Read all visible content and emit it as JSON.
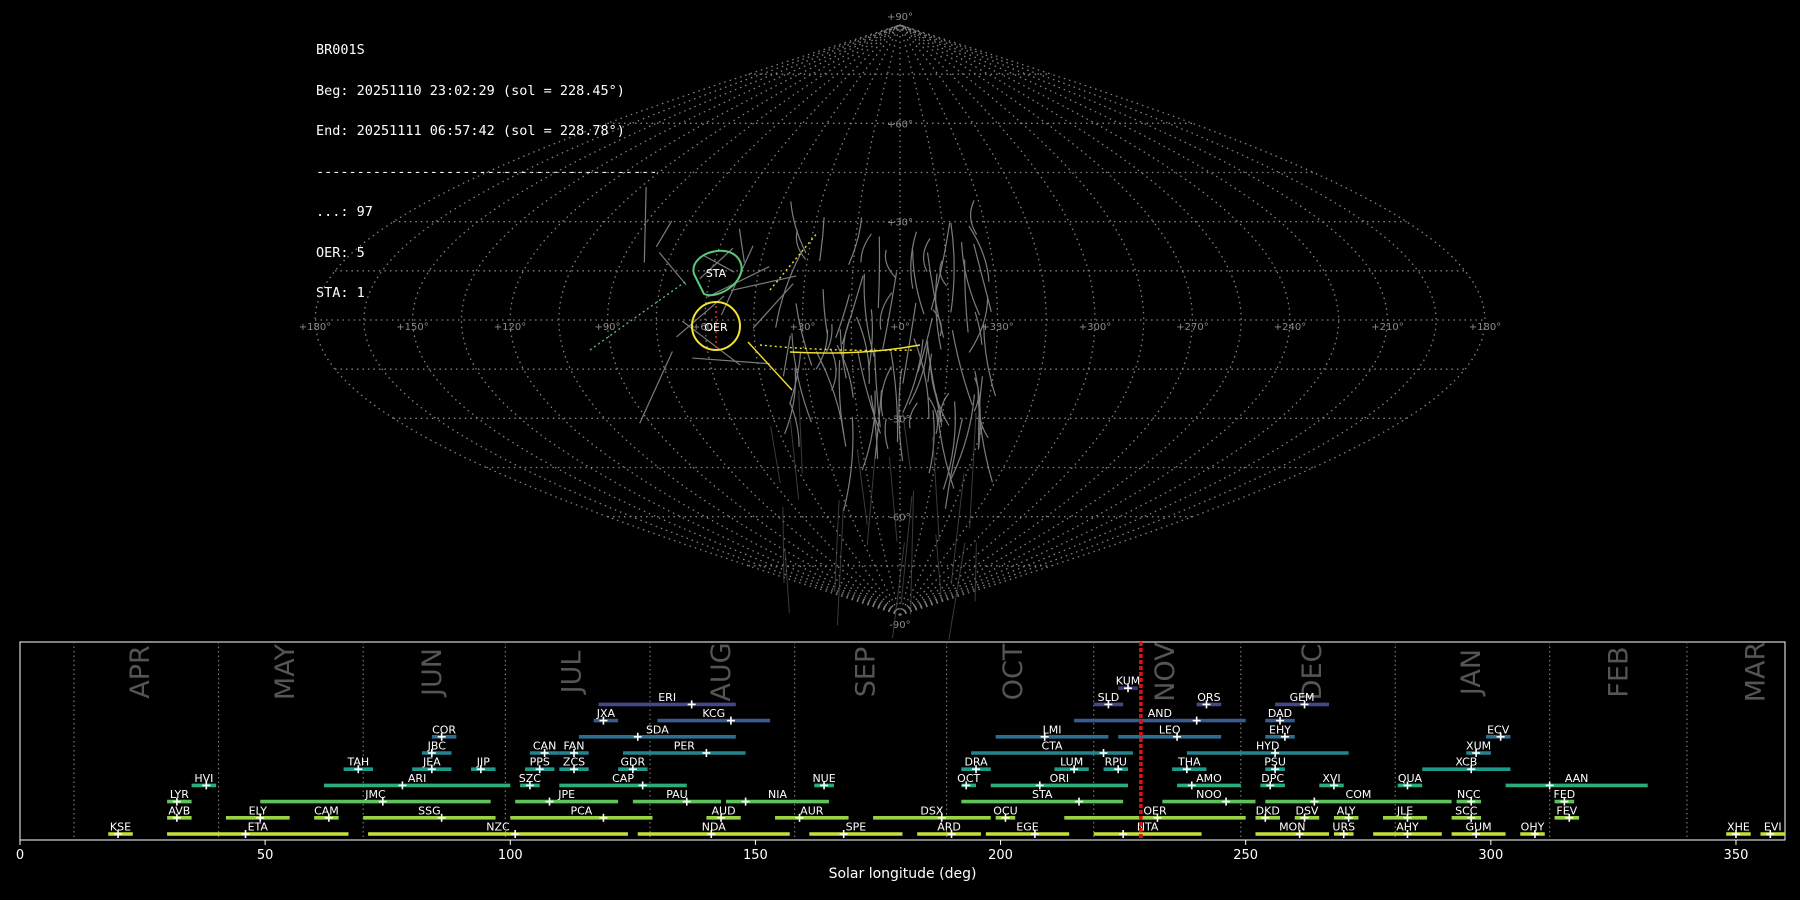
{
  "info": {
    "station": "BR001S",
    "beg": "Beg: 20251110 23:02:29 (sol = 228.45°)",
    "end": "End: 20251111 06:57:42 (sol = 228.78°)",
    "separator": "------------------------------------------",
    "counts": [
      "...: 97",
      "OER: 5",
      "STA: 1"
    ]
  },
  "sky": {
    "lat_labels": [
      "+90°",
      "+60°",
      "+30°",
      "-30°",
      "-60°",
      "-90°"
    ],
    "lon_labels": [
      "+180°",
      "+150°",
      "+120°",
      "+90°",
      "+60°",
      "+30°",
      "+0°",
      "+330°",
      "+300°",
      "+270°",
      "+240°",
      "+210°",
      "+180°"
    ],
    "radiants": [
      {
        "code": "STA",
        "lon": 58,
        "lat": 10,
        "color": "#5cc87a"
      },
      {
        "code": "OER",
        "lon": 58,
        "lat": 0,
        "color": "#f2e330"
      }
    ],
    "line_color": "#8a8a8a",
    "grid_color": "#9a9a9a"
  },
  "chart_data": {
    "type": "timeline",
    "xlabel": "Solar longitude (deg)",
    "xlim": [
      0,
      360
    ],
    "xticks": [
      0,
      50,
      100,
      150,
      200,
      250,
      300,
      350
    ],
    "current_sol": [
      228.45,
      228.78
    ],
    "months": [
      {
        "name": "APR",
        "start": 11,
        "mid": 24.5
      },
      {
        "name": "MAY",
        "start": 40.5,
        "mid": 54
      },
      {
        "name": "JUN",
        "start": 70,
        "mid": 84
      },
      {
        "name": "JUL",
        "start": 99,
        "mid": 112.5
      },
      {
        "name": "AUG",
        "start": 128.5,
        "mid": 143
      },
      {
        "name": "SEP",
        "start": 158,
        "mid": 172.5
      },
      {
        "name": "OCT",
        "start": 189,
        "mid": 202.5
      },
      {
        "name": "NOV",
        "start": 219,
        "mid": 233.5
      },
      {
        "name": "DEC",
        "start": 249,
        "mid": 263.5
      },
      {
        "name": "JAN",
        "start": 280.5,
        "mid": 296
      },
      {
        "name": "FEB",
        "start": 312,
        "mid": 326
      },
      {
        "name": "MAR",
        "start": 340,
        "mid": 354
      }
    ],
    "showers": [
      {
        "code": "KUM",
        "start": 224,
        "end": 228,
        "peak": 226,
        "row": 10
      },
      {
        "code": "ERI",
        "start": 118,
        "end": 146,
        "peak": 137,
        "row": 9
      },
      {
        "code": "SLD",
        "start": 219,
        "end": 225,
        "peak": 222,
        "row": 9
      },
      {
        "code": "ORS",
        "start": 240,
        "end": 245,
        "peak": 242,
        "row": 9
      },
      {
        "code": "GEM",
        "start": 256,
        "end": 267,
        "peak": 262,
        "row": 9
      },
      {
        "code": "JXA",
        "start": 117,
        "end": 122,
        "peak": 119,
        "row": 8
      },
      {
        "code": "KCG",
        "start": 130,
        "end": 153,
        "peak": 145,
        "row": 8
      },
      {
        "code": "AND",
        "start": 215,
        "end": 250,
        "peak": 240,
        "row": 8
      },
      {
        "code": "DAD",
        "start": 254,
        "end": 260,
        "peak": 257,
        "row": 8
      },
      {
        "code": "COR",
        "start": 84,
        "end": 89,
        "peak": 86,
        "row": 7
      },
      {
        "code": "SDA",
        "start": 114,
        "end": 146,
        "peak": 126,
        "row": 7
      },
      {
        "code": "LMI",
        "start": 199,
        "end": 222,
        "peak": 209,
        "row": 7
      },
      {
        "code": "LEO",
        "start": 224,
        "end": 245,
        "peak": 236,
        "row": 7
      },
      {
        "code": "EHY",
        "start": 254,
        "end": 260,
        "peak": 258,
        "row": 7
      },
      {
        "code": "ECV",
        "start": 299,
        "end": 304,
        "peak": 302,
        "row": 7
      },
      {
        "code": "JBC",
        "start": 82,
        "end": 88,
        "peak": 84,
        "row": 6
      },
      {
        "code": "CAN",
        "start": 104,
        "end": 110,
        "peak": 107,
        "row": 6
      },
      {
        "code": "FAN",
        "start": 110,
        "end": 116,
        "peak": 113,
        "row": 6
      },
      {
        "code": "PER",
        "start": 123,
        "end": 148,
        "peak": 140,
        "row": 6
      },
      {
        "code": "CTA",
        "start": 194,
        "end": 227,
        "peak": 221,
        "row": 6
      },
      {
        "code": "HYD",
        "start": 238,
        "end": 271,
        "peak": 256,
        "row": 6
      },
      {
        "code": "XUM",
        "start": 295,
        "end": 300,
        "peak": 297,
        "row": 6
      },
      {
        "code": "TAH",
        "start": 66,
        "end": 72,
        "peak": 69,
        "row": 5
      },
      {
        "code": "JEA",
        "start": 80,
        "end": 88,
        "peak": 84,
        "row": 5
      },
      {
        "code": "JIP",
        "start": 92,
        "end": 97,
        "peak": 94,
        "row": 5
      },
      {
        "code": "PPS",
        "start": 103,
        "end": 109,
        "peak": 106,
        "row": 5
      },
      {
        "code": "ZCS",
        "start": 110,
        "end": 116,
        "peak": 113,
        "row": 5
      },
      {
        "code": "GDR",
        "start": 122,
        "end": 128,
        "peak": 125,
        "row": 5
      },
      {
        "code": "DRA",
        "start": 192,
        "end": 198,
        "peak": 195,
        "row": 5
      },
      {
        "code": "LUM",
        "start": 211,
        "end": 218,
        "peak": 215,
        "row": 5
      },
      {
        "code": "RPU",
        "start": 221,
        "end": 226,
        "peak": 224,
        "row": 5
      },
      {
        "code": "THA",
        "start": 235,
        "end": 242,
        "peak": 238,
        "row": 5
      },
      {
        "code": "PSU",
        "start": 254,
        "end": 258,
        "peak": 256,
        "row": 5
      },
      {
        "code": "XCB",
        "start": 286,
        "end": 304,
        "peak": 296,
        "row": 5
      },
      {
        "code": "HVI",
        "start": 35,
        "end": 40,
        "peak": 38,
        "row": 4
      },
      {
        "code": "ARI",
        "start": 62,
        "end": 100,
        "peak": 78,
        "row": 4
      },
      {
        "code": "SZC",
        "start": 102,
        "end": 106,
        "peak": 104,
        "row": 4
      },
      {
        "code": "CAP",
        "start": 110,
        "end": 136,
        "peak": 127,
        "row": 4
      },
      {
        "code": "NUE",
        "start": 162,
        "end": 166,
        "peak": 164,
        "row": 4
      },
      {
        "code": "OCT",
        "start": 192,
        "end": 195,
        "peak": 193,
        "row": 4
      },
      {
        "code": "ORI",
        "start": 198,
        "end": 226,
        "peak": 208,
        "row": 4
      },
      {
        "code": "AMO",
        "start": 236,
        "end": 249,
        "peak": 239,
        "row": 4
      },
      {
        "code": "DPC",
        "start": 253,
        "end": 258,
        "peak": 255,
        "row": 4
      },
      {
        "code": "XVI",
        "start": 265,
        "end": 270,
        "peak": 268,
        "row": 4
      },
      {
        "code": "QUA",
        "start": 281,
        "end": 286,
        "peak": 283,
        "row": 4
      },
      {
        "code": "AAN",
        "start": 303,
        "end": 332,
        "peak": 312,
        "row": 4
      },
      {
        "code": "LYR",
        "start": 30,
        "end": 35,
        "peak": 32,
        "row": 3
      },
      {
        "code": "JMC",
        "start": 49,
        "end": 96,
        "peak": 74,
        "row": 3
      },
      {
        "code": "JPE",
        "start": 101,
        "end": 122,
        "peak": 108,
        "row": 3
      },
      {
        "code": "PAU",
        "start": 125,
        "end": 143,
        "peak": 136,
        "row": 3
      },
      {
        "code": "NIA",
        "start": 144,
        "end": 165,
        "peak": 148,
        "row": 3
      },
      {
        "code": "STA",
        "start": 192,
        "end": 225,
        "peak": 216,
        "row": 3
      },
      {
        "code": "NOO",
        "start": 233,
        "end": 252,
        "peak": 246,
        "row": 3
      },
      {
        "code": "COM",
        "start": 254,
        "end": 292,
        "peak": 264,
        "row": 3
      },
      {
        "code": "NCC",
        "start": 293,
        "end": 298,
        "peak": 296,
        "row": 3
      },
      {
        "code": "FED",
        "start": 313,
        "end": 317,
        "peak": 315,
        "row": 3
      },
      {
        "code": "AVB",
        "start": 30,
        "end": 35,
        "peak": 32,
        "row": 2
      },
      {
        "code": "ELY",
        "start": 42,
        "end": 55,
        "peak": 49,
        "row": 2
      },
      {
        "code": "CAM",
        "start": 60,
        "end": 65,
        "peak": 63,
        "row": 2
      },
      {
        "code": "SSG",
        "start": 70,
        "end": 97,
        "peak": 86,
        "row": 2
      },
      {
        "code": "PCA",
        "start": 100,
        "end": 129,
        "peak": 119,
        "row": 2
      },
      {
        "code": "AUD",
        "start": 140,
        "end": 147,
        "peak": 143,
        "row": 2
      },
      {
        "code": "AUR",
        "start": 154,
        "end": 169,
        "peak": 159,
        "row": 2
      },
      {
        "code": "DSX",
        "start": 174,
        "end": 198,
        "peak": 188,
        "row": 2
      },
      {
        "code": "OCU",
        "start": 199,
        "end": 203,
        "peak": 201,
        "row": 2
      },
      {
        "code": "OER",
        "start": 213,
        "end": 250,
        "peak": 232,
        "row": 2
      },
      {
        "code": "DKD",
        "start": 252,
        "end": 257,
        "peak": 254,
        "row": 2
      },
      {
        "code": "DSV",
        "start": 260,
        "end": 265,
        "peak": 262,
        "row": 2
      },
      {
        "code": "ALY",
        "start": 268,
        "end": 273,
        "peak": 271,
        "row": 2
      },
      {
        "code": "JLE",
        "start": 278,
        "end": 287,
        "peak": 283,
        "row": 2
      },
      {
        "code": "SCC",
        "start": 292,
        "end": 298,
        "peak": 296,
        "row": 2
      },
      {
        "code": "FEV",
        "start": 313,
        "end": 318,
        "peak": 316,
        "row": 2
      },
      {
        "code": "KSE",
        "start": 18,
        "end": 23,
        "peak": 20,
        "row": 1
      },
      {
        "code": "ETA",
        "start": 30,
        "end": 67,
        "peak": 46,
        "row": 1
      },
      {
        "code": "NZC",
        "start": 71,
        "end": 124,
        "peak": 101,
        "row": 1
      },
      {
        "code": "NDA",
        "start": 126,
        "end": 157,
        "peak": 141,
        "row": 1
      },
      {
        "code": "SPE",
        "start": 161,
        "end": 180,
        "peak": 168,
        "row": 1
      },
      {
        "code": "ARD",
        "start": 183,
        "end": 196,
        "peak": 190,
        "row": 1
      },
      {
        "code": "EGE",
        "start": 197,
        "end": 214,
        "peak": 207,
        "row": 1
      },
      {
        "code": "NTA",
        "start": 219,
        "end": 241,
        "peak": 225,
        "row": 1
      },
      {
        "code": "MON",
        "start": 252,
        "end": 267,
        "peak": 261,
        "row": 1
      },
      {
        "code": "URS",
        "start": 268,
        "end": 272,
        "peak": 270,
        "row": 1
      },
      {
        "code": "AHY",
        "start": 276,
        "end": 290,
        "peak": 283,
        "row": 1
      },
      {
        "code": "GUM",
        "start": 292,
        "end": 303,
        "peak": 297,
        "row": 1
      },
      {
        "code": "OHY",
        "start": 306,
        "end": 311,
        "peak": 309,
        "row": 1
      },
      {
        "code": "XHE",
        "start": 348,
        "end": 353,
        "peak": 350,
        "row": 1
      },
      {
        "code": "EVI",
        "start": 355,
        "end": 360,
        "peak": 357,
        "row": 1
      }
    ]
  }
}
